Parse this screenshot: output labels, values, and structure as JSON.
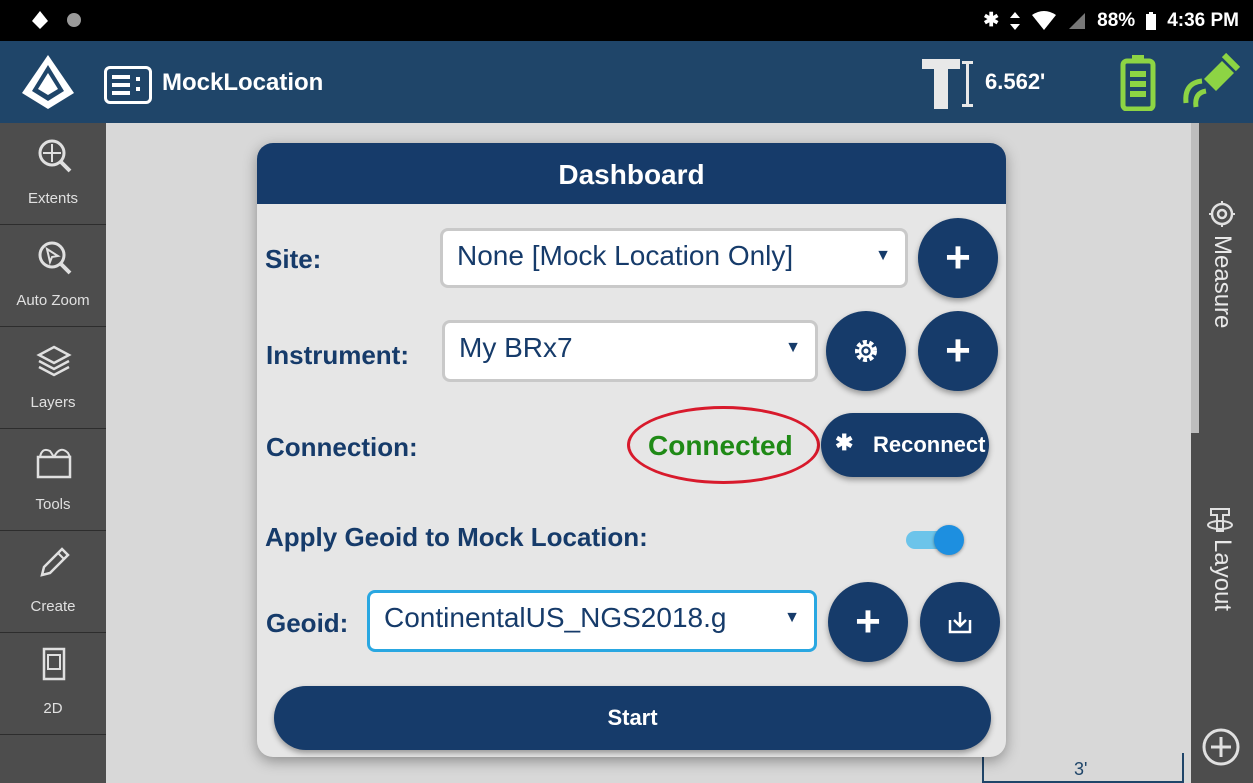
{
  "status_bar": {
    "battery_percent": "88%",
    "time": "4:36 PM",
    "icons": [
      "bluetooth-icon",
      "data-arrows-icon",
      "wifi-icon",
      "no-sim-icon",
      "battery-icon"
    ]
  },
  "app_bar": {
    "title": "MockLocation",
    "pole_height": "6.562'"
  },
  "sidebar": {
    "items": [
      {
        "label": "Extents",
        "icon": "extents-icon"
      },
      {
        "label": "Auto Zoom",
        "icon": "auto-zoom-icon"
      },
      {
        "label": "Layers",
        "icon": "layers-icon"
      },
      {
        "label": "Tools",
        "icon": "toolbox-icon"
      },
      {
        "label": "Create",
        "icon": "pencil-icon"
      },
      {
        "label": "2D",
        "icon": "view-2d-icon"
      }
    ]
  },
  "right_panel": {
    "measure_label": "Measure",
    "layout_label": "Layout"
  },
  "map": {
    "scale_label": "3'"
  },
  "dashboard": {
    "title": "Dashboard",
    "site_label": "Site:",
    "site_value": "None [Mock Location Only]",
    "instrument_label": "Instrument:",
    "instrument_value": "My BRx7",
    "connection_label": "Connection:",
    "connection_status": "Connected",
    "reconnect_label": "Reconnect",
    "apply_geoid_label": "Apply Geoid to Mock Location:",
    "apply_geoid_on": true,
    "geoid_label": "Geoid:",
    "geoid_value": "ContinentalUS_NGS2018.g",
    "start_label": "Start"
  },
  "colors": {
    "primary": "#163b6a",
    "appbar": "#1f4569",
    "connected": "#1f8a16",
    "highlight_ring": "#d81a2c",
    "toggle_on": "#1d8fe0"
  }
}
